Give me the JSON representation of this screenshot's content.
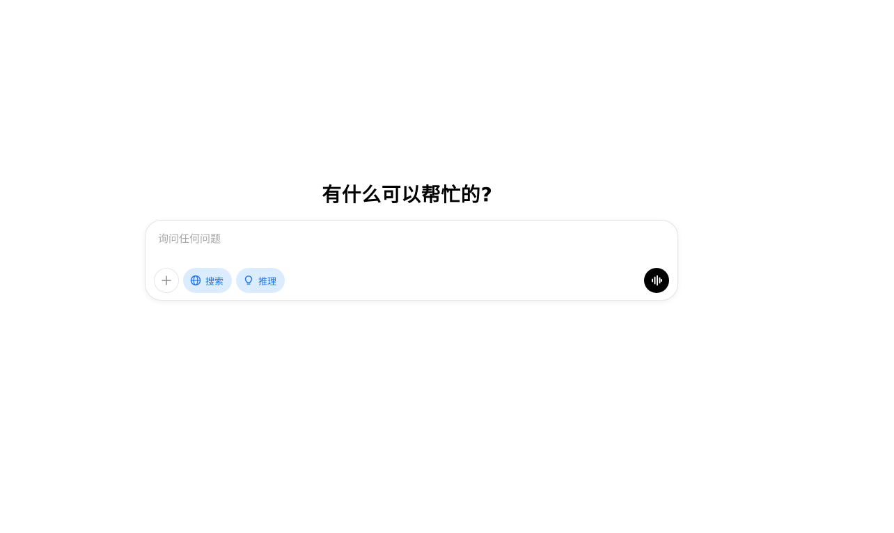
{
  "main": {
    "headline": "有什么可以帮忙的?"
  },
  "composer": {
    "placeholder": "询问任何问题",
    "value": "",
    "attach_icon": "plus-icon",
    "chips": [
      {
        "label": "搜索",
        "icon": "globe-icon"
      },
      {
        "label": "推理",
        "icon": "lightbulb-icon"
      }
    ],
    "voice_icon": "voice-waveform-icon"
  },
  "colors": {
    "chip_bg": "#dcecff",
    "chip_text": "#1a73e8",
    "voice_button_bg": "#000000"
  }
}
